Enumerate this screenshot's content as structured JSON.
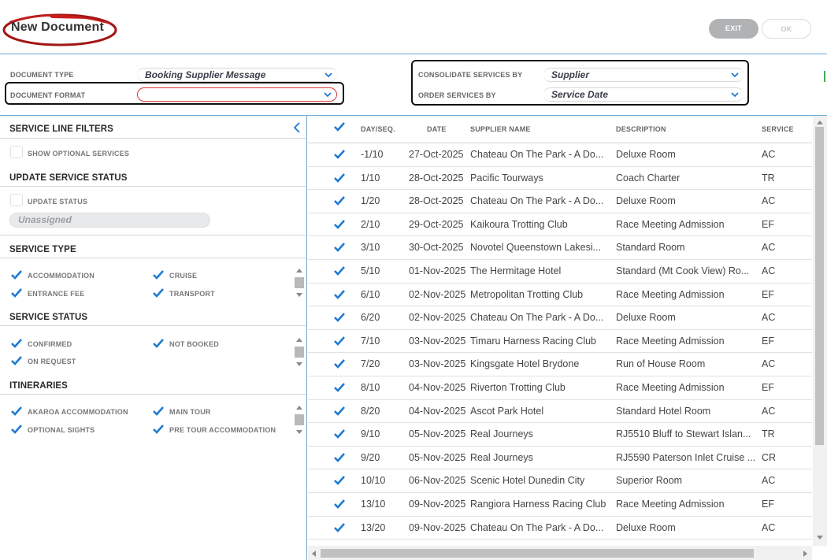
{
  "header": {
    "title": "New Document",
    "exit_label": "EXIT",
    "ok_label": "OK"
  },
  "document_options": {
    "document_type_label": "DOCUMENT TYPE",
    "document_type_value": "Booking Supplier Message",
    "document_format_label": "DOCUMENT FORMAT",
    "document_format_value": "",
    "consolidate_label": "CONSOLIDATE SERVICES BY",
    "consolidate_value": "Supplier",
    "order_label": "ORDER SERVICES BY",
    "order_value": "Service Date"
  },
  "filters": {
    "title": "SERVICE LINE FILTERS",
    "show_optional_label": "SHOW OPTIONAL SERVICES",
    "update_section_title": "UPDATE SERVICE STATUS",
    "update_status_label": "UPDATE STATUS",
    "status_value": "Unassigned",
    "service_type_title": "SERVICE TYPE",
    "service_types": [
      "ACCOMMODATION",
      "CRUISE",
      "ENTRANCE FEE",
      "TRANSPORT"
    ],
    "service_status_title": "SERVICE STATUS",
    "service_statuses": [
      "CONFIRMED",
      "NOT BOOKED",
      "ON REQUEST"
    ],
    "itineraries_title": "ITINERARIES",
    "itineraries": [
      "AKAROA ACCOMMODATION",
      "MAIN TOUR",
      "OPTIONAL SIGHTS",
      "PRE TOUR ACCOMMODATION"
    ]
  },
  "table": {
    "columns": [
      "DAY/SEQ.",
      "DATE",
      "SUPPLIER NAME",
      "DESCRIPTION",
      "SERVICE"
    ],
    "rows": [
      {
        "day": "-1/10",
        "date": "27-Oct-2025",
        "supplier": "Chateau On The Park - A Do...",
        "description": "Deluxe Room",
        "service": "AC"
      },
      {
        "day": "1/10",
        "date": "28-Oct-2025",
        "supplier": "Pacific Tourways",
        "description": "Coach Charter",
        "service": "TR"
      },
      {
        "day": "1/20",
        "date": "28-Oct-2025",
        "supplier": "Chateau On The Park - A Do...",
        "description": "Deluxe Room",
        "service": "AC"
      },
      {
        "day": "2/10",
        "date": "29-Oct-2025",
        "supplier": "Kaikoura Trotting Club",
        "description": "Race Meeting Admission",
        "service": "EF"
      },
      {
        "day": "3/10",
        "date": "30-Oct-2025",
        "supplier": "Novotel Queenstown Lakesi...",
        "description": "Standard Room",
        "service": "AC"
      },
      {
        "day": "5/10",
        "date": "01-Nov-2025",
        "supplier": "The Hermitage Hotel",
        "description": "Standard (Mt Cook View) Ro...",
        "service": "AC"
      },
      {
        "day": "6/10",
        "date": "02-Nov-2025",
        "supplier": "Metropolitan Trotting Club",
        "description": "Race Meeting Admission",
        "service": "EF"
      },
      {
        "day": "6/20",
        "date": "02-Nov-2025",
        "supplier": "Chateau On The Park - A Do...",
        "description": "Deluxe Room",
        "service": "AC"
      },
      {
        "day": "7/10",
        "date": "03-Nov-2025",
        "supplier": "Timaru Harness Racing Club",
        "description": "Race Meeting Admission",
        "service": "EF"
      },
      {
        "day": "7/20",
        "date": "03-Nov-2025",
        "supplier": "Kingsgate Hotel Brydone",
        "description": "Run of House Room",
        "service": "AC"
      },
      {
        "day": "8/10",
        "date": "04-Nov-2025",
        "supplier": "Riverton Trotting Club",
        "description": "Race Meeting Admission",
        "service": "EF"
      },
      {
        "day": "8/20",
        "date": "04-Nov-2025",
        "supplier": "Ascot Park Hotel",
        "description": "Standard Hotel Room",
        "service": "AC"
      },
      {
        "day": "9/10",
        "date": "05-Nov-2025",
        "supplier": "Real Journeys",
        "description": "RJ5510 Bluff to Stewart Islan...",
        "service": "TR"
      },
      {
        "day": "9/20",
        "date": "05-Nov-2025",
        "supplier": "Real Journeys",
        "description": "RJ5590 Paterson Inlet Cruise ...",
        "service": "CR"
      },
      {
        "day": "10/10",
        "date": "06-Nov-2025",
        "supplier": "Scenic Hotel Dunedin City",
        "description": "Superior Room",
        "service": "AC"
      },
      {
        "day": "13/10",
        "date": "09-Nov-2025",
        "supplier": "Rangiora Harness Racing Club",
        "description": "Race Meeting Admission",
        "service": "EF"
      },
      {
        "day": "13/20",
        "date": "09-Nov-2025",
        "supplier": "Chateau On The Park - A Do...",
        "description": "Deluxe Room",
        "service": "AC"
      }
    ]
  },
  "colors": {
    "accent_blue": "#1f7ad1",
    "annotation_red": "#c81e1e",
    "divider_blue": "#6ea9d6",
    "exit_gray": "#b0b2b4"
  },
  "icons": [
    "chevron-down-icon",
    "chevron-left-icon",
    "check-icon",
    "scroll-arrow-icon"
  ]
}
